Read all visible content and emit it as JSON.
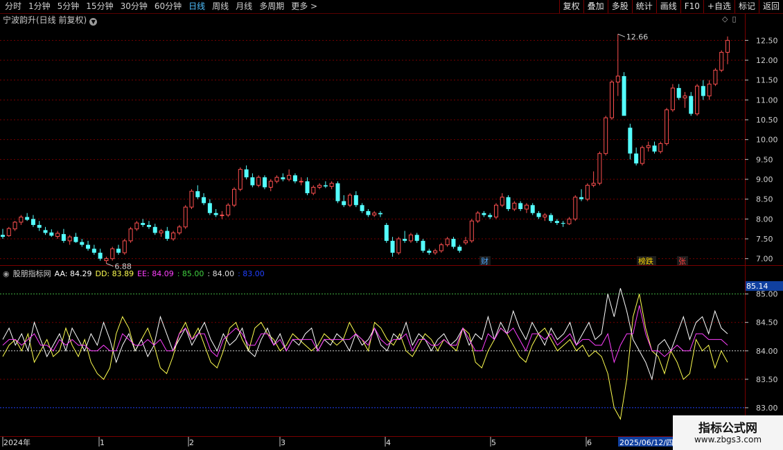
{
  "toolbar": {
    "periods": [
      "分时",
      "1分钟",
      "5分钟",
      "15分钟",
      "30分钟",
      "60分钟",
      "日线",
      "周线",
      "月线",
      "多周期",
      "更多 >"
    ],
    "active_period": "日线",
    "buttons": [
      "复权",
      "叠加",
      "多股",
      "统计",
      "画线",
      "F10",
      "+自选",
      "标记",
      "返回"
    ]
  },
  "stock_title": "宁波韵升(日线 前复权)",
  "price_axis": {
    "labels": [
      "12.50",
      "12.00",
      "11.50",
      "11.00",
      "10.50",
      "10.00",
      "9.50",
      "9.00",
      "8.50",
      "8.00",
      "7.50",
      "7.00"
    ],
    "high_label": "12.66",
    "low_label": "6.88"
  },
  "event_tags": [
    {
      "text": "财",
      "color": "#4fa8ff"
    },
    {
      "text": "榜跌",
      "color": "#ffd700"
    },
    {
      "text": "张",
      "color": "#ff4040"
    }
  ],
  "indicator": {
    "name": "股朋指标网",
    "values": [
      {
        "label": "AA: 84.29",
        "color": "#ffffff"
      },
      {
        "label": "DD: 83.89",
        "color": "#ffff50"
      },
      {
        "label": "EE: 84.09",
        "color": "#ff40ff"
      },
      {
        "label": ": 85.00",
        "color": "#40d040"
      },
      {
        "label": ": 84.00",
        "color": "#e0e0e0"
      },
      {
        "label": ": 83.00",
        "color": "#2040ff"
      }
    ],
    "axis_labels": [
      "85.00",
      "84.50",
      "84.00",
      "83.50",
      "83.00"
    ],
    "current_value": "85.14"
  },
  "date_axis": {
    "labels": [
      "2024年",
      "1",
      "2",
      "3",
      "4",
      "5",
      "6"
    ],
    "current_date": "2025/06/12/四"
  },
  "watermark": {
    "line1": "指标公式网",
    "line2": "www.zbgs3.com"
  },
  "colors": {
    "up": "#ff5050",
    "down": "#54ffff",
    "grid": "#7a0000",
    "aa": "#ffffff",
    "dd": "#ffff50",
    "ee": "#ff40ff"
  },
  "chart_data": {
    "type": "candlestick",
    "ylim": [
      6.75,
      12.75
    ],
    "candles": [
      [
        7.6,
        7.75,
        7.5,
        7.55
      ],
      [
        7.58,
        7.8,
        7.55,
        7.76
      ],
      [
        7.75,
        7.95,
        7.7,
        7.92
      ],
      [
        7.92,
        8.1,
        7.85,
        8.05
      ],
      [
        8.05,
        8.15,
        7.95,
        7.98
      ],
      [
        8.0,
        8.1,
        7.8,
        7.85
      ],
      [
        7.85,
        7.95,
        7.7,
        7.78
      ],
      [
        7.72,
        7.8,
        7.6,
        7.65
      ],
      [
        7.66,
        7.74,
        7.55,
        7.58
      ],
      [
        7.56,
        7.7,
        7.5,
        7.64
      ],
      [
        7.62,
        7.75,
        7.4,
        7.45
      ],
      [
        7.45,
        7.6,
        7.35,
        7.55
      ],
      [
        7.55,
        7.65,
        7.4,
        7.42
      ],
      [
        7.42,
        7.5,
        7.3,
        7.35
      ],
      [
        7.35,
        7.45,
        7.2,
        7.25
      ],
      [
        7.25,
        7.35,
        7.1,
        7.15
      ],
      [
        7.15,
        7.25,
        6.95,
        7.0
      ],
      [
        6.95,
        7.05,
        6.88,
        7.0
      ],
      [
        7.0,
        7.3,
        6.95,
        7.25
      ],
      [
        7.25,
        7.35,
        7.1,
        7.15
      ],
      [
        7.15,
        7.5,
        7.1,
        7.45
      ],
      [
        7.45,
        7.8,
        7.4,
        7.75
      ],
      [
        7.75,
        7.95,
        7.7,
        7.9
      ],
      [
        7.9,
        8.0,
        7.8,
        7.85
      ],
      [
        7.85,
        7.95,
        7.75,
        7.8
      ],
      [
        7.8,
        7.88,
        7.6,
        7.65
      ],
      [
        7.65,
        7.75,
        7.55,
        7.7
      ],
      [
        7.7,
        7.8,
        7.45,
        7.5
      ],
      [
        7.5,
        7.7,
        7.45,
        7.65
      ],
      [
        7.65,
        7.85,
        7.6,
        7.8
      ],
      [
        7.8,
        8.35,
        7.75,
        8.3
      ],
      [
        8.3,
        8.75,
        8.25,
        8.7
      ],
      [
        8.7,
        8.85,
        8.5,
        8.55
      ],
      [
        8.55,
        8.65,
        8.35,
        8.4
      ],
      [
        8.4,
        8.5,
        8.1,
        8.15
      ],
      [
        8.15,
        8.25,
        8.05,
        8.1
      ],
      [
        8.1,
        8.2,
        8.0,
        8.1
      ],
      [
        8.1,
        8.4,
        8.05,
        8.35
      ],
      [
        8.35,
        8.8,
        8.3,
        8.75
      ],
      [
        8.75,
        9.3,
        8.7,
        9.25
      ],
      [
        9.25,
        9.35,
        9.0,
        9.05
      ],
      [
        9.05,
        9.15,
        8.8,
        8.85
      ],
      [
        8.85,
        9.1,
        8.8,
        9.05
      ],
      [
        9.05,
        9.1,
        8.75,
        8.8
      ],
      [
        8.8,
        9.0,
        8.7,
        8.95
      ],
      [
        8.95,
        9.1,
        8.9,
        9.05
      ],
      [
        9.05,
        9.15,
        8.95,
        9.0
      ],
      [
        9.0,
        9.25,
        8.95,
        9.1
      ],
      [
        9.1,
        9.15,
        8.9,
        8.95
      ],
      [
        8.95,
        9.05,
        8.85,
        8.95
      ],
      [
        8.95,
        9.05,
        8.6,
        8.65
      ],
      [
        8.65,
        8.85,
        8.6,
        8.8
      ],
      [
        8.8,
        8.9,
        8.75,
        8.85
      ],
      [
        8.85,
        8.95,
        8.78,
        8.82
      ],
      [
        8.82,
        8.95,
        8.75,
        8.9
      ],
      [
        8.9,
        8.95,
        8.4,
        8.45
      ],
      [
        8.45,
        8.6,
        8.3,
        8.35
      ],
      [
        8.35,
        8.65,
        8.3,
        8.6
      ],
      [
        8.6,
        8.7,
        8.3,
        8.35
      ],
      [
        8.35,
        8.4,
        8.15,
        8.2
      ],
      [
        8.2,
        8.25,
        8.05,
        8.1
      ],
      [
        8.1,
        8.2,
        8.05,
        8.15
      ],
      [
        8.15,
        8.2,
        8.05,
        8.12
      ],
      [
        7.85,
        7.9,
        7.4,
        7.45
      ],
      [
        7.45,
        7.55,
        7.05,
        7.15
      ],
      [
        7.15,
        7.55,
        7.1,
        7.5
      ],
      [
        7.5,
        7.7,
        7.4,
        7.45
      ],
      [
        7.45,
        7.65,
        7.4,
        7.6
      ],
      [
        7.6,
        7.65,
        7.4,
        7.45
      ],
      [
        7.45,
        7.5,
        7.15,
        7.2
      ],
      [
        7.2,
        7.25,
        7.1,
        7.15
      ],
      [
        7.15,
        7.25,
        7.1,
        7.2
      ],
      [
        7.2,
        7.4,
        7.15,
        7.35
      ],
      [
        7.35,
        7.55,
        7.3,
        7.5
      ],
      [
        7.5,
        7.55,
        7.25,
        7.3
      ],
      [
        7.3,
        7.35,
        7.15,
        7.2
      ],
      [
        7.4,
        7.55,
        7.35,
        7.45
      ],
      [
        7.45,
        8.0,
        7.4,
        7.95
      ],
      [
        7.95,
        8.2,
        7.9,
        8.15
      ],
      [
        8.15,
        8.2,
        8.05,
        8.1
      ],
      [
        8.1,
        8.15,
        8.0,
        8.05
      ],
      [
        8.05,
        8.4,
        8.0,
        8.35
      ],
      [
        8.35,
        8.65,
        8.3,
        8.55
      ],
      [
        8.55,
        8.6,
        8.2,
        8.25
      ],
      [
        8.25,
        8.45,
        8.2,
        8.4
      ],
      [
        8.4,
        8.45,
        8.2,
        8.25
      ],
      [
        8.25,
        8.4,
        8.15,
        8.35
      ],
      [
        8.35,
        8.4,
        8.1,
        8.15
      ],
      [
        8.15,
        8.2,
        8.0,
        8.05
      ],
      [
        8.05,
        8.15,
        7.95,
        8.1
      ],
      [
        8.1,
        8.15,
        7.9,
        7.95
      ],
      [
        7.95,
        8.0,
        7.85,
        7.9
      ],
      [
        7.9,
        7.95,
        7.8,
        7.88
      ],
      [
        7.88,
        8.05,
        7.85,
        8.0
      ],
      [
        8.0,
        8.6,
        7.95,
        8.55
      ],
      [
        8.55,
        8.75,
        8.45,
        8.5
      ],
      [
        8.5,
        8.9,
        8.45,
        8.85
      ],
      [
        8.85,
        9.2,
        8.8,
        8.9
      ],
      [
        8.9,
        9.7,
        8.85,
        9.65
      ],
      [
        9.65,
        10.6,
        9.6,
        10.55
      ],
      [
        10.55,
        11.5,
        10.5,
        11.45
      ],
      [
        11.45,
        12.66,
        11.1,
        11.6
      ],
      [
        11.6,
        11.7,
        10.7,
        10.6
      ],
      [
        10.3,
        10.4,
        9.5,
        9.65
      ],
      [
        9.65,
        9.8,
        9.35,
        9.4
      ],
      [
        9.4,
        9.85,
        9.35,
        9.8
      ],
      [
        9.8,
        9.95,
        9.7,
        9.85
      ],
      [
        9.85,
        9.95,
        9.65,
        9.7
      ],
      [
        9.7,
        9.95,
        9.65,
        9.9
      ],
      [
        9.9,
        10.8,
        9.85,
        10.75
      ],
      [
        10.75,
        11.4,
        10.7,
        11.3
      ],
      [
        11.3,
        11.4,
        11.0,
        11.05
      ],
      [
        11.05,
        11.2,
        10.8,
        11.1
      ],
      [
        11.1,
        11.2,
        10.6,
        10.65
      ],
      [
        10.65,
        11.4,
        10.6,
        11.35
      ],
      [
        11.35,
        11.5,
        11.0,
        11.1
      ],
      [
        11.1,
        11.5,
        11.0,
        11.4
      ],
      [
        11.4,
        11.8,
        11.35,
        11.75
      ],
      [
        11.75,
        12.25,
        11.7,
        12.2
      ],
      [
        12.2,
        12.6,
        11.9,
        12.5
      ]
    ],
    "indicator_ylim": [
      82.5,
      85.3
    ],
    "aa": [
      84.2,
      84.4,
      84.1,
      84.3,
      84.0,
      84.5,
      84.2,
      83.9,
      84.1,
      84.3,
      84.0,
      84.4,
      84.2,
      84.0,
      84.3,
      84.1,
      84.5,
      84.2,
      83.8,
      84.1,
      84.3,
      84.0,
      84.2,
      83.9,
      84.1,
      84.6,
      84.3,
      84.0,
      84.2,
      84.4,
      84.1,
      84.3,
      84.5,
      84.2,
      84.0,
      84.3,
      84.1,
      84.2,
      84.4,
      84.0,
      83.9,
      84.2,
      84.4,
      84.1,
      84.3,
      84.0,
      84.2,
      84.1,
      84.3,
      84.4,
      84.0,
      84.2,
      84.1,
      84.3,
      84.2,
      84.0,
      84.3,
      84.1,
      84.2,
      84.4,
      84.1,
      84.0,
      84.3,
      84.2,
      84.5,
      84.1,
      84.3,
      84.2,
      84.0,
      84.2,
      84.3,
      84.1,
      84.2,
      84.4,
      84.1,
      84.3,
      84.2,
      84.6,
      84.2,
      84.5,
      84.3,
      84.7,
      84.4,
      84.2,
      84.5,
      84.3,
      84.1,
      84.4,
      84.2,
      84.3,
      84.5,
      84.1,
      84.3,
      84.5,
      84.2,
      84.3,
      85.0,
      84.6,
      85.1,
      84.7,
      84.2,
      84.0,
      83.8,
      83.5,
      84.1,
      84.2,
      84.0,
      84.3,
      84.6,
      84.2,
      84.5,
      84.6,
      84.3,
      84.7,
      84.4,
      84.3
    ],
    "dd": [
      83.9,
      84.1,
      84.2,
      84.0,
      84.3,
      83.8,
      84.0,
      84.2,
      83.9,
      84.0,
      84.4,
      84.1,
      83.9,
      84.2,
      83.8,
      83.6,
      83.5,
      83.7,
      84.3,
      84.6,
      84.4,
      84.0,
      84.2,
      84.4,
      84.1,
      83.7,
      83.6,
      83.9,
      84.3,
      84.5,
      84.2,
      84.4,
      84.1,
      83.8,
      83.7,
      84.0,
      84.4,
      84.5,
      84.2,
      84.0,
      84.4,
      84.5,
      84.3,
      84.2,
      84.0,
      84.1,
      84.3,
      84.2,
      84.1,
      84.0,
      84.1,
      84.3,
      84.2,
      84.1,
      84.2,
      84.5,
      84.3,
      84.2,
      84.0,
      84.5,
      84.4,
      84.2,
      84.1,
      84.3,
      84.0,
      83.9,
      84.1,
      84.3,
      84.2,
      84.0,
      84.2,
      84.1,
      84.0,
      84.4,
      84.3,
      83.8,
      83.7,
      84.0,
      84.2,
      84.4,
      84.3,
      84.1,
      83.9,
      83.8,
      84.1,
      84.3,
      84.4,
      84.2,
      84.0,
      84.1,
      84.2,
      84.0,
      84.1,
      83.9,
      84.0,
      83.9,
      83.6,
      83.0,
      82.8,
      83.5,
      84.6,
      85.0,
      84.4,
      84.0,
      83.9,
      83.6,
      84.0,
      83.8,
      83.5,
      83.6,
      84.2,
      84.0,
      84.1,
      83.7,
      84.0,
      83.8
    ],
    "ee": [
      84.1,
      84.2,
      84.2,
      84.1,
      84.2,
      84.3,
      84.1,
      84.1,
      84.0,
      84.2,
      84.1,
      84.2,
      84.1,
      84.1,
      84.0,
      84.0,
      84.1,
      84.0,
      84.0,
      84.3,
      84.2,
      84.1,
      84.1,
      84.2,
      84.1,
      84.2,
      84.0,
      84.0,
      84.3,
      84.4,
      84.2,
      84.3,
      84.3,
      84.0,
      83.9,
      84.2,
      84.3,
      84.4,
      84.3,
      84.1,
      84.1,
      84.3,
      84.3,
      84.1,
      84.2,
      84.0,
      84.2,
      84.2,
      84.2,
      84.2,
      84.0,
      84.2,
      84.2,
      84.2,
      84.2,
      84.2,
      84.3,
      84.2,
      84.1,
      84.4,
      84.2,
      84.1,
      84.2,
      84.2,
      84.3,
      84.0,
      84.2,
      84.2,
      84.1,
      84.1,
      84.2,
      84.1,
      84.1,
      84.4,
      84.2,
      84.0,
      84.0,
      84.3,
      84.2,
      84.4,
      84.3,
      84.4,
      84.2,
      84.0,
      84.3,
      84.3,
      84.2,
      84.3,
      84.1,
      84.2,
      84.3,
      84.1,
      84.2,
      84.2,
      84.1,
      84.1,
      84.3,
      83.8,
      84.1,
      84.3,
      84.3,
      84.8,
      84.3,
      84.0,
      84.0,
      83.9,
      84.0,
      84.1,
      84.0,
      84.0,
      84.3,
      84.3,
      84.2,
      84.2,
      84.2,
      84.1
    ]
  }
}
